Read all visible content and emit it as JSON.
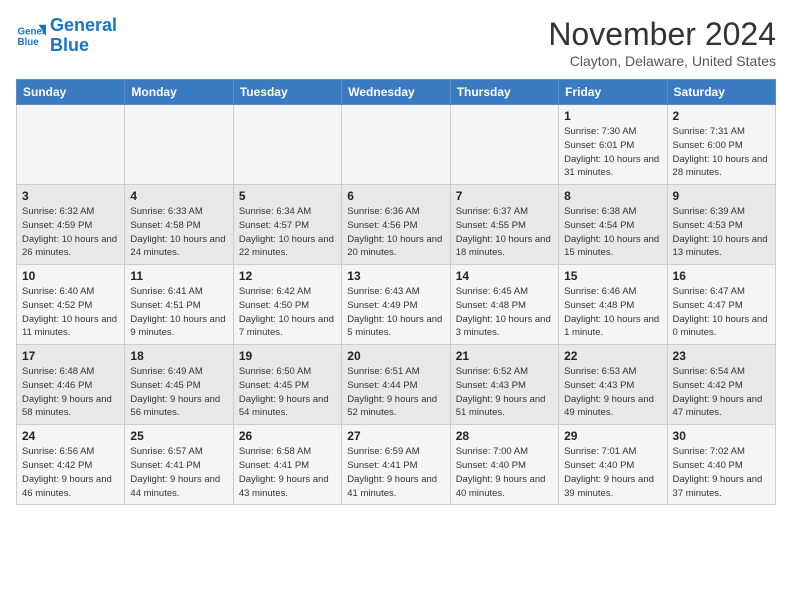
{
  "logo": {
    "line1": "General",
    "line2": "Blue"
  },
  "title": "November 2024",
  "subtitle": "Clayton, Delaware, United States",
  "days_of_week": [
    "Sunday",
    "Monday",
    "Tuesday",
    "Wednesday",
    "Thursday",
    "Friday",
    "Saturday"
  ],
  "weeks": [
    [
      {
        "day": "",
        "info": ""
      },
      {
        "day": "",
        "info": ""
      },
      {
        "day": "",
        "info": ""
      },
      {
        "day": "",
        "info": ""
      },
      {
        "day": "",
        "info": ""
      },
      {
        "day": "1",
        "info": "Sunrise: 7:30 AM\nSunset: 6:01 PM\nDaylight: 10 hours and 31 minutes."
      },
      {
        "day": "2",
        "info": "Sunrise: 7:31 AM\nSunset: 6:00 PM\nDaylight: 10 hours and 28 minutes."
      }
    ],
    [
      {
        "day": "3",
        "info": "Sunrise: 6:32 AM\nSunset: 4:59 PM\nDaylight: 10 hours and 26 minutes."
      },
      {
        "day": "4",
        "info": "Sunrise: 6:33 AM\nSunset: 4:58 PM\nDaylight: 10 hours and 24 minutes."
      },
      {
        "day": "5",
        "info": "Sunrise: 6:34 AM\nSunset: 4:57 PM\nDaylight: 10 hours and 22 minutes."
      },
      {
        "day": "6",
        "info": "Sunrise: 6:36 AM\nSunset: 4:56 PM\nDaylight: 10 hours and 20 minutes."
      },
      {
        "day": "7",
        "info": "Sunrise: 6:37 AM\nSunset: 4:55 PM\nDaylight: 10 hours and 18 minutes."
      },
      {
        "day": "8",
        "info": "Sunrise: 6:38 AM\nSunset: 4:54 PM\nDaylight: 10 hours and 15 minutes."
      },
      {
        "day": "9",
        "info": "Sunrise: 6:39 AM\nSunset: 4:53 PM\nDaylight: 10 hours and 13 minutes."
      }
    ],
    [
      {
        "day": "10",
        "info": "Sunrise: 6:40 AM\nSunset: 4:52 PM\nDaylight: 10 hours and 11 minutes."
      },
      {
        "day": "11",
        "info": "Sunrise: 6:41 AM\nSunset: 4:51 PM\nDaylight: 10 hours and 9 minutes."
      },
      {
        "day": "12",
        "info": "Sunrise: 6:42 AM\nSunset: 4:50 PM\nDaylight: 10 hours and 7 minutes."
      },
      {
        "day": "13",
        "info": "Sunrise: 6:43 AM\nSunset: 4:49 PM\nDaylight: 10 hours and 5 minutes."
      },
      {
        "day": "14",
        "info": "Sunrise: 6:45 AM\nSunset: 4:48 PM\nDaylight: 10 hours and 3 minutes."
      },
      {
        "day": "15",
        "info": "Sunrise: 6:46 AM\nSunset: 4:48 PM\nDaylight: 10 hours and 1 minute."
      },
      {
        "day": "16",
        "info": "Sunrise: 6:47 AM\nSunset: 4:47 PM\nDaylight: 10 hours and 0 minutes."
      }
    ],
    [
      {
        "day": "17",
        "info": "Sunrise: 6:48 AM\nSunset: 4:46 PM\nDaylight: 9 hours and 58 minutes."
      },
      {
        "day": "18",
        "info": "Sunrise: 6:49 AM\nSunset: 4:45 PM\nDaylight: 9 hours and 56 minutes."
      },
      {
        "day": "19",
        "info": "Sunrise: 6:50 AM\nSunset: 4:45 PM\nDaylight: 9 hours and 54 minutes."
      },
      {
        "day": "20",
        "info": "Sunrise: 6:51 AM\nSunset: 4:44 PM\nDaylight: 9 hours and 52 minutes."
      },
      {
        "day": "21",
        "info": "Sunrise: 6:52 AM\nSunset: 4:43 PM\nDaylight: 9 hours and 51 minutes."
      },
      {
        "day": "22",
        "info": "Sunrise: 6:53 AM\nSunset: 4:43 PM\nDaylight: 9 hours and 49 minutes."
      },
      {
        "day": "23",
        "info": "Sunrise: 6:54 AM\nSunset: 4:42 PM\nDaylight: 9 hours and 47 minutes."
      }
    ],
    [
      {
        "day": "24",
        "info": "Sunrise: 6:56 AM\nSunset: 4:42 PM\nDaylight: 9 hours and 46 minutes."
      },
      {
        "day": "25",
        "info": "Sunrise: 6:57 AM\nSunset: 4:41 PM\nDaylight: 9 hours and 44 minutes."
      },
      {
        "day": "26",
        "info": "Sunrise: 6:58 AM\nSunset: 4:41 PM\nDaylight: 9 hours and 43 minutes."
      },
      {
        "day": "27",
        "info": "Sunrise: 6:59 AM\nSunset: 4:41 PM\nDaylight: 9 hours and 41 minutes."
      },
      {
        "day": "28",
        "info": "Sunrise: 7:00 AM\nSunset: 4:40 PM\nDaylight: 9 hours and 40 minutes."
      },
      {
        "day": "29",
        "info": "Sunrise: 7:01 AM\nSunset: 4:40 PM\nDaylight: 9 hours and 39 minutes."
      },
      {
        "day": "30",
        "info": "Sunrise: 7:02 AM\nSunset: 4:40 PM\nDaylight: 9 hours and 37 minutes."
      }
    ]
  ]
}
